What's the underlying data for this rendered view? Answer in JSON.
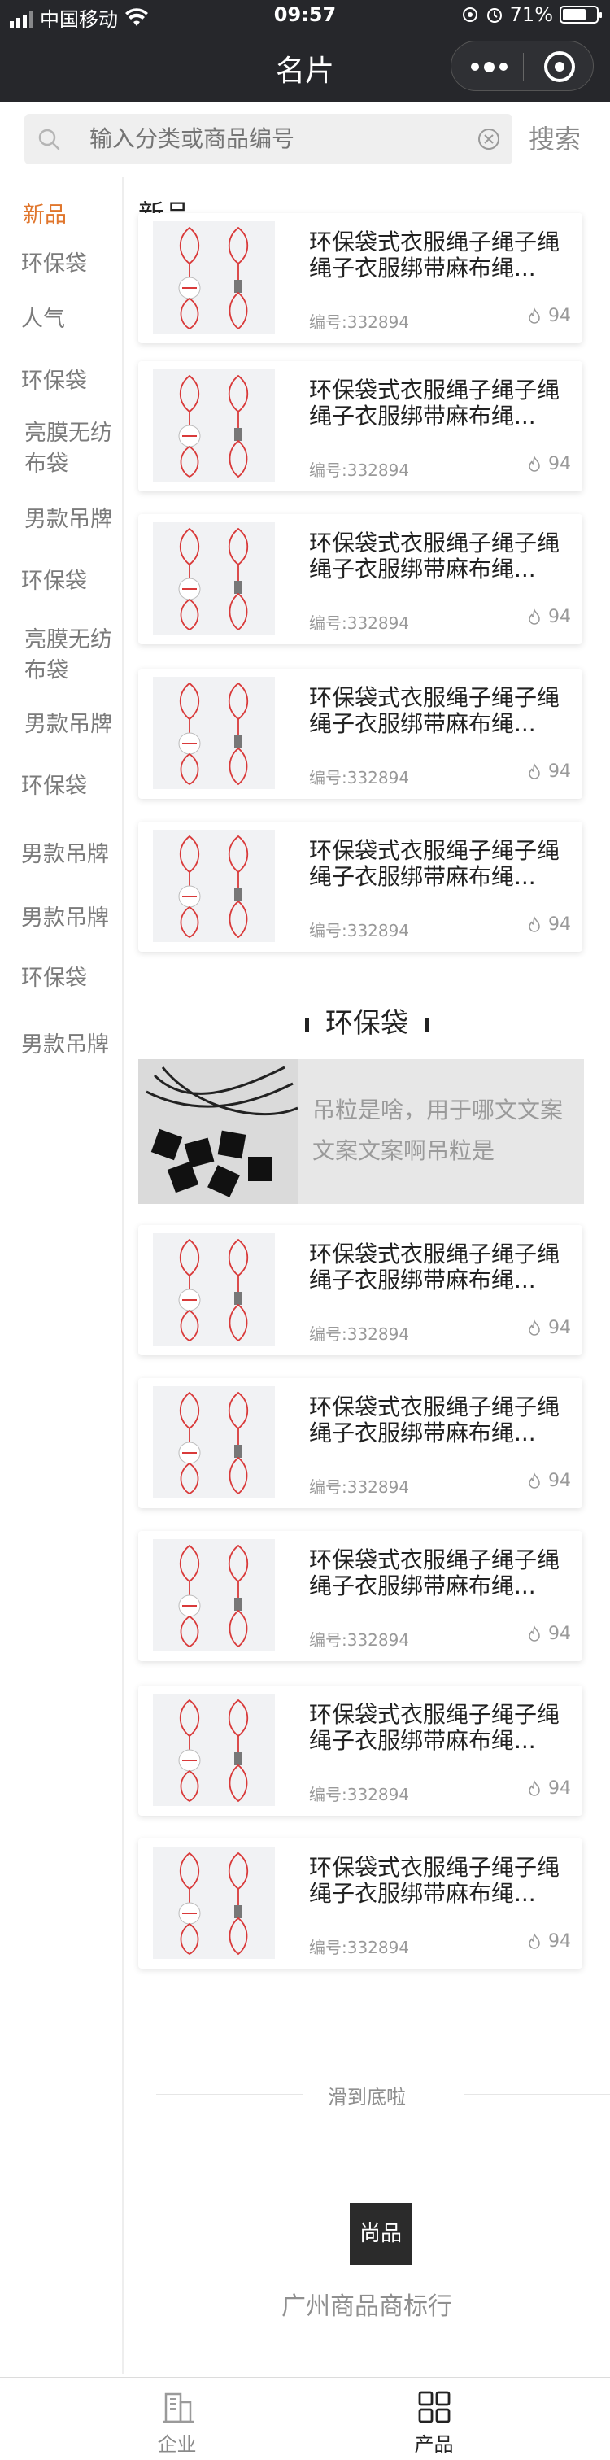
{
  "status_bar": {
    "carrier": "中国移动",
    "time": "09:57",
    "battery": "71%",
    "battery_level": 0.71
  },
  "nav": {
    "title": "名片"
  },
  "search": {
    "placeholder": "输入分类或商品编号",
    "button_label": "搜索"
  },
  "sidebar": {
    "items": [
      {
        "label": "新品",
        "active": true
      },
      {
        "label": "环保袋"
      },
      {
        "label": "人气"
      },
      {
        "label": "环保袋"
      },
      {
        "label": "亮膜无纺布袋"
      },
      {
        "label": "男款吊牌"
      },
      {
        "label": "环保袋"
      },
      {
        "label": "亮膜无纺布袋"
      },
      {
        "label": "男款吊牌"
      },
      {
        "label": "环保袋"
      },
      {
        "label": "男款吊牌"
      },
      {
        "label": "男款吊牌"
      },
      {
        "label": "环保袋"
      },
      {
        "label": "男款吊牌"
      }
    ]
  },
  "sections": [
    {
      "title": "新品",
      "products": [
        {
          "name": "环保袋式衣服绳子绳子绳绳子衣服绑带麻布绳...",
          "code": "编号:332894",
          "hot": "94"
        },
        {
          "name": "环保袋式衣服绳子绳子绳绳子衣服绑带麻布绳...",
          "code": "编号:332894",
          "hot": "94"
        },
        {
          "name": "环保袋式衣服绳子绳子绳绳子衣服绑带麻布绳...",
          "code": "编号:332894",
          "hot": "94"
        },
        {
          "name": "环保袋式衣服绳子绳子绳绳子衣服绑带麻布绳...",
          "code": "编号:332894",
          "hot": "94"
        },
        {
          "name": "环保袋式衣服绳子绳子绳绳子衣服绑带麻布绳...",
          "code": "编号:332894",
          "hot": "94"
        }
      ]
    },
    {
      "title": "环保袋",
      "banner_text": "吊粒是啥，用于哪文文案文案文案啊吊粒是",
      "products": [
        {
          "name": "环保袋式衣服绳子绳子绳绳子衣服绑带麻布绳...",
          "code": "编号:332894",
          "hot": "94"
        },
        {
          "name": "环保袋式衣服绳子绳子绳绳子衣服绑带麻布绳...",
          "code": "编号:332894",
          "hot": "94"
        },
        {
          "name": "环保袋式衣服绳子绳子绳绳子衣服绑带麻布绳...",
          "code": "编号:332894",
          "hot": "94"
        },
        {
          "name": "环保袋式衣服绳子绳子绳绳子衣服绑带麻布绳...",
          "code": "编号:332894",
          "hot": "94"
        },
        {
          "name": "环保袋式衣服绳子绳子绳绳子衣服绑带麻布绳...",
          "code": "编号:332894",
          "hot": "94"
        }
      ]
    }
  ],
  "footer": {
    "end_text": "滑到底啦",
    "brand_logo": "尚品",
    "brand_name": "广州商品商标行"
  },
  "tabbar": [
    {
      "label": "企业",
      "icon": "building-icon"
    },
    {
      "label": "产品",
      "icon": "grid-icon",
      "active": true
    }
  ],
  "colors": {
    "accent": "#e0762d",
    "header_bg": "#26272b",
    "tag_red": "#d93a3a"
  }
}
